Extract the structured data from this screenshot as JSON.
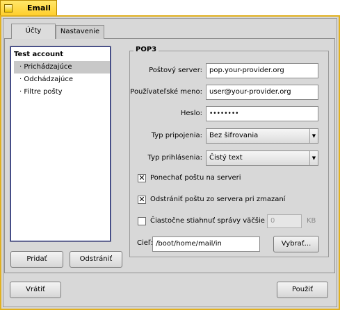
{
  "window": {
    "title": "Email"
  },
  "tabs": [
    {
      "label": "Účty",
      "active": true
    },
    {
      "label": "Nastavenie",
      "active": false
    }
  ],
  "account_list": {
    "account": "Test account",
    "items": [
      "· Prichádzajúce",
      "· Odchádzajúce",
      "· Filtre pošty"
    ],
    "selected_index": 0
  },
  "list_buttons": {
    "add": "Pridať",
    "remove": "Odstrániť"
  },
  "pop3": {
    "group_title": "POP3",
    "server_label": "Poštový server:",
    "server_value": "pop.your-provider.org",
    "user_label": "Používateľské meno:",
    "user_value": "user@your-provider.org",
    "password_label": "Heslo:",
    "password_value": "••••••••",
    "connection_label": "Typ pripojenia:",
    "connection_value": "Bez šifrovania",
    "login_label": "Typ prihlásenia:",
    "login_value": "Čistý text",
    "leave_on_server": {
      "label": "Ponechať poštu na serveri",
      "checked": true
    },
    "delete_on_server": {
      "label": "Odstrániť poštu zo servera pri zmazaní",
      "checked": true
    },
    "partial_download": {
      "label": "Čiastočne stiahnuť správy väčšie ako",
      "checked": false,
      "value": "0",
      "unit": "KB"
    },
    "destination_label": "Cieľ:",
    "destination_value": "/boot/home/mail/in",
    "browse_label": "Vybrať..."
  },
  "footer": {
    "revert": "Vrátiť",
    "apply": "Použiť"
  },
  "colors": {
    "tab_accent": "#ffcf2e",
    "list_border": "#1e2c7a",
    "selection": "#c8c8c8"
  }
}
